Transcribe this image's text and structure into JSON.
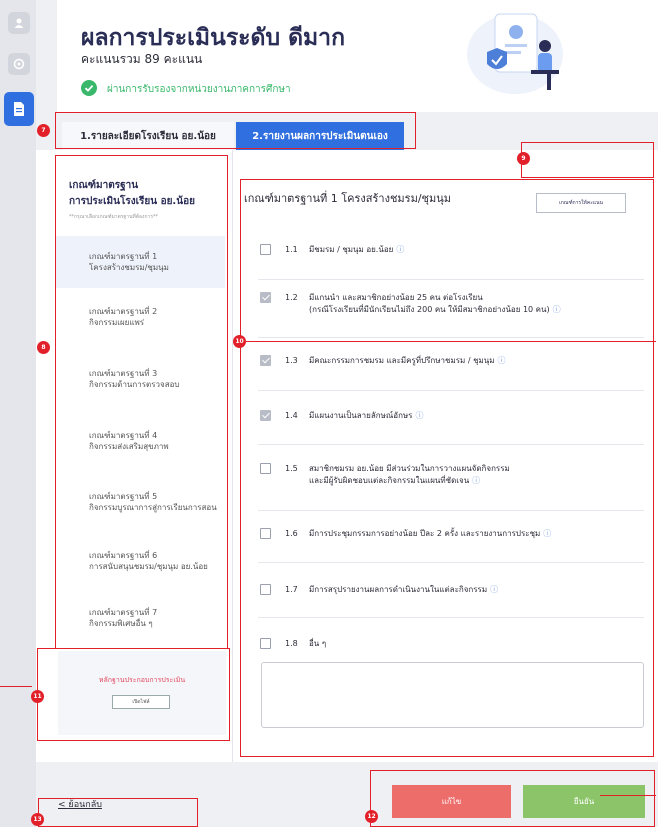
{
  "header": {
    "title": "ผลการประเมินระดับ ดีมาก",
    "score": "คะแนนรวม 89 คะแนน",
    "certified": "ผ่านการรับรองจากหน่วยงานภาคการศึกษา"
  },
  "tabs": [
    {
      "label": "1.รายละเอียดโรงเรียน อย.น้อย",
      "active": false
    },
    {
      "label": "2.รายงานผลการประเมินตนเอง",
      "active": true
    }
  ],
  "sidebar": {
    "title_line1": "เกณฑ์มาตรฐาน",
    "title_line2": "การประเมินโรงเรียน อย.น้อย",
    "hint": "**กรุณาเลือกเกณฑ์มาตรฐานที่ต้องการ**",
    "items": [
      {
        "line1": "เกณฑ์มาตรฐานที่ 1",
        "line2": "โครงสร้างชมรม/ชุมนุม",
        "active": true
      },
      {
        "line1": "เกณฑ์มาตรฐานที่ 2",
        "line2": "กิจกรรมเผยแพร่",
        "active": false
      },
      {
        "line1": "เกณฑ์มาตรฐานที่ 3",
        "line2": "กิจกรรมด้านการตรวจสอบ",
        "active": false
      },
      {
        "line1": "เกณฑ์มาตรฐานที่ 4",
        "line2": "กิจกรรมส่งเสริมสุขภาพ",
        "active": false
      },
      {
        "line1": "เกณฑ์มาตรฐานที่ 5",
        "line2": "กิจกรรมบูรณาการสู่การเรียนการสอน",
        "active": false
      },
      {
        "line1": "เกณฑ์มาตรฐานที่ 6",
        "line2": "การสนับสนุนชมรม/ชุมนุม อย.น้อย",
        "active": false
      },
      {
        "line1": "เกณฑ์มาตรฐานที่ 7",
        "line2": "กิจกรรมพิเศษอื่น ๆ",
        "active": false
      }
    ],
    "evidence_title": "หลักฐานประกอบการประเมิน",
    "evidence_button": "เปิดไฟล์"
  },
  "panel": {
    "title": "เกณฑ์มาตรฐานที่ 1 โครงสร้างชมรม/ชุมนุม",
    "criteria_button": "เกณฑ์การให้คะแนน",
    "items": [
      {
        "num": "1.1",
        "line1": "มีชมรม / ชุมนุม อย.น้อย",
        "line2": "",
        "checked": false
      },
      {
        "num": "1.2",
        "line1": "มีแกนนำ และสมาชิกอย่างน้อย 25 คน ต่อโรงเรียน",
        "line2": "(กรณีโรงเรียนที่มีนักเรียนไม่ถึง 200 คน ให้มีสมาชิกอย่างน้อย 10 คน)",
        "checked": true
      },
      {
        "num": "1.3",
        "line1": "มีคณะกรรมการชมรม และมีครูที่ปรึกษาชมรม / ชุมนุม",
        "line2": "",
        "checked": true
      },
      {
        "num": "1.4",
        "line1": "มีแผนงานเป็นลายลักษณ์อักษร",
        "line2": "",
        "checked": true
      },
      {
        "num": "1.5",
        "line1": "สมาชิกชมรม อย.น้อย มีส่วนร่วมในการวางแผนจัดกิจกรรม",
        "line2": "และมีผู้รับผิดชอบแต่ละกิจกรรมในแผนที่ชัดเจน",
        "checked": false
      },
      {
        "num": "1.6",
        "line1": "มีการประชุมกรรมการอย่างน้อย ปีละ 2 ครั้ง และรายงานการประชุม",
        "line2": "",
        "checked": false
      },
      {
        "num": "1.7",
        "line1": "มีการสรุปรายงานผลการดำเนินงานในแต่ละกิจกรรม",
        "line2": "",
        "checked": false
      },
      {
        "num": "1.8",
        "line1": "อื่น ๆ",
        "line2": "",
        "checked": false
      }
    ],
    "info_glyph": "ⓘ"
  },
  "footer": {
    "back_label": "ย้อนกลับ",
    "back_arrow": "<",
    "edit_label": "แก้ไข",
    "confirm_label": "ยืนยัน"
  },
  "annotations": {
    "m7": "7",
    "m8": "8",
    "m9": "9",
    "m10": "10",
    "m11": "11",
    "m12": "12",
    "m13": "13"
  }
}
